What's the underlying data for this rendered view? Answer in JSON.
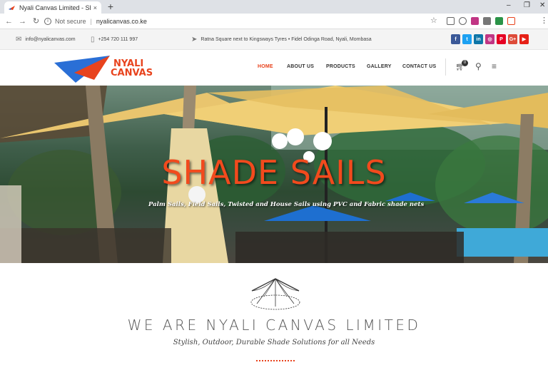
{
  "browser": {
    "tab_title": "Nyali Canvas Limited - Shade Sa",
    "tab_close": "×",
    "new_tab": "+",
    "security_label": "Not secure",
    "url": "nyalicanvas.co.ke",
    "win_minimize": "–",
    "win_maximize": "❐",
    "win_close": "✕"
  },
  "topbar": {
    "email": "info@nyalicanvas.com",
    "phone": "+254 720 111 997",
    "address": "Ratna Square next to Kingsways Tyres • Fidel Odinga Road, Nyali, Mombasa",
    "socials": [
      {
        "icon": "facebook-icon",
        "glyph": "f",
        "color": "#3b5998"
      },
      {
        "icon": "twitter-icon",
        "glyph": "t",
        "color": "#1da1f2"
      },
      {
        "icon": "linkedin-icon",
        "glyph": "in",
        "color": "#0e76a8"
      },
      {
        "icon": "instagram-icon",
        "glyph": "◎",
        "color": "#c13584"
      },
      {
        "icon": "pinterest-icon",
        "glyph": "P",
        "color": "#e60023"
      },
      {
        "icon": "googleplus-icon",
        "glyph": "G+",
        "color": "#dd4b39"
      },
      {
        "icon": "youtube-icon",
        "glyph": "▶",
        "color": "#e62117"
      }
    ]
  },
  "header": {
    "logo_line1": "NYALI",
    "logo_line2": "CANVAS",
    "nav": [
      "HOME",
      "ABOUT US",
      "PRODUCTS",
      "GALLERY",
      "CONTACT US"
    ],
    "active_nav": "HOME",
    "cart_count": "0",
    "accent": "#e8431d"
  },
  "hero": {
    "title": "SHADE SAILS",
    "subtitle": "Palm Sails, Field Sails, Twisted and House Sails using PVC and Fabric shade nets"
  },
  "about": {
    "title": "WE ARE NYALI CANVAS LIMITED",
    "subtitle": "Stylish, Outdoor, Durable Shade Solutions for all Needs"
  }
}
